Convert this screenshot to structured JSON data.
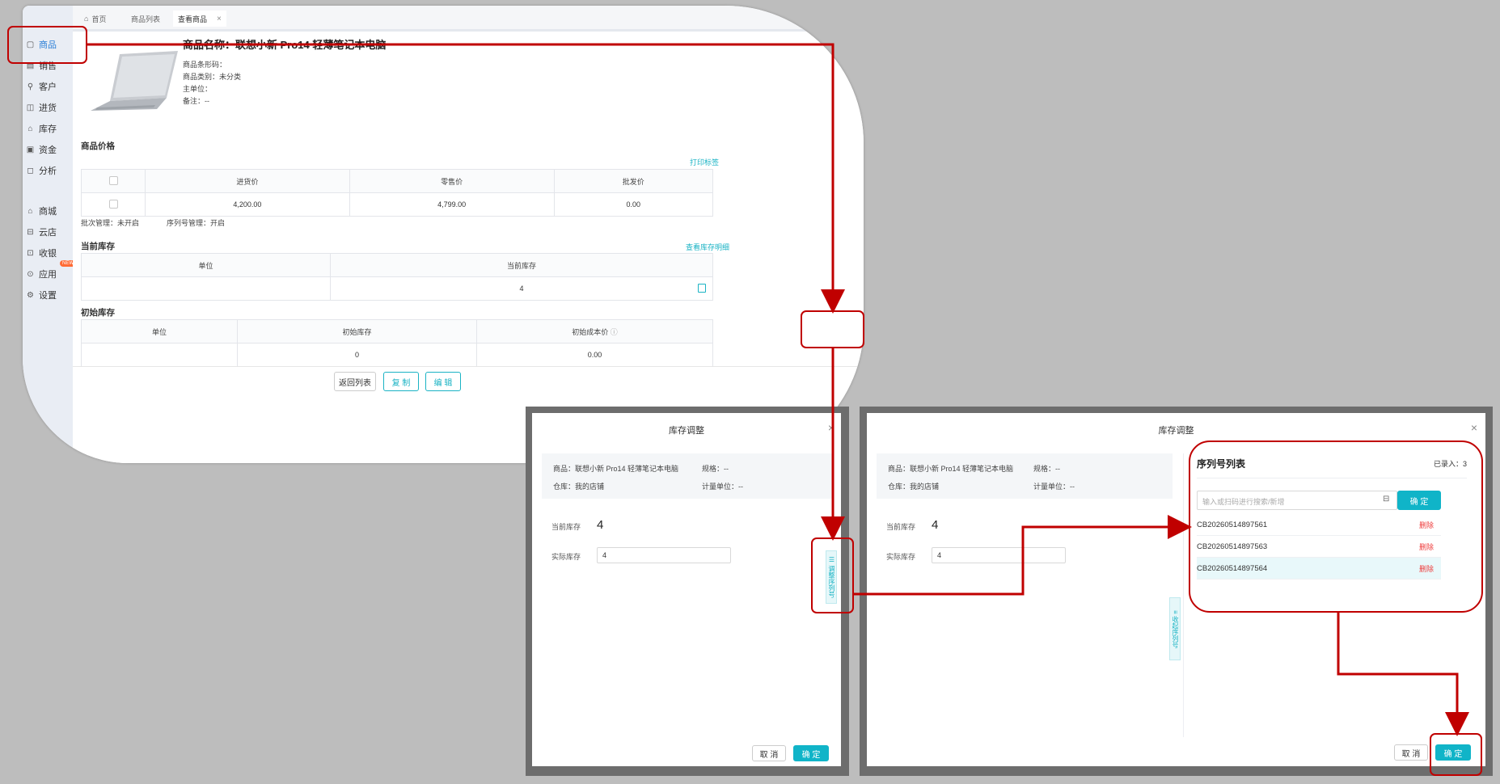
{
  "app": {
    "sidebar": [
      {
        "label": "商品",
        "icon": "box-icon",
        "active": true
      },
      {
        "label": "销售",
        "icon": "clipboard-icon"
      },
      {
        "label": "客户",
        "icon": "user-icon"
      },
      {
        "label": "进货",
        "icon": "truck-icon"
      },
      {
        "label": "库存",
        "icon": "warehouse-icon"
      },
      {
        "label": "资金",
        "icon": "wallet-icon"
      },
      {
        "label": "分析",
        "icon": "chart-icon"
      },
      {
        "label": "商城",
        "icon": "shop-icon"
      },
      {
        "label": "云店",
        "icon": "store-icon"
      },
      {
        "label": "收银",
        "icon": "monitor-icon"
      },
      {
        "label": "应用",
        "icon": "app-icon",
        "badge": "NEW"
      },
      {
        "label": "设置",
        "icon": "gear-icon"
      }
    ],
    "tabs": [
      "首页",
      "商品列表",
      "查看商品"
    ],
    "product": {
      "title": "商品名称：联想小新 Pro14 轻薄笔记本电脑",
      "barcode": "商品条形码：",
      "category": "商品类别：未分类",
      "unit": "主单位：",
      "remark": "备注：--"
    },
    "price_section": "商品价格",
    "print_tag": "打印标签",
    "price_headers": [
      "进货价",
      "零售价",
      "批发价"
    ],
    "price_values": [
      "4,200.00",
      "4,799.00",
      "0.00"
    ],
    "batch_mgmt": "批次管理：未开启",
    "serial_mgmt": "序列号管理：开启",
    "current_stock_section": "当前库存",
    "view_stock_link": "查看库存明细",
    "current_headers": [
      "单位",
      "当前库存"
    ],
    "current_values": [
      "",
      "4"
    ],
    "initial_stock_section": "初始库存",
    "initial_headers": [
      "单位",
      "初始库存",
      "初始成本价"
    ],
    "initial_values": [
      "",
      "0",
      "0.00"
    ],
    "buttons": {
      "back": "返回列表",
      "copy": "复 制",
      "edit": "编 辑"
    }
  },
  "dialog1": {
    "title": "库存调整",
    "product": "商品：联想小新 Pro14 轻薄笔记本电脑",
    "spec": "规格：--",
    "warehouse": "仓库：我的店铺",
    "measure_unit": "计量单位：--",
    "current_label": "当前库存",
    "current_value": "4",
    "actual_label": "实际库存",
    "actual_value": "4",
    "serial_btn": "☰ 调整序列号",
    "cancel": "取 消",
    "ok": "确 定"
  },
  "dialog2": {
    "title": "库存调整",
    "product": "商品：联想小新 Pro14 轻薄笔记本电脑",
    "spec": "规格：--",
    "warehouse": "仓库：我的店铺",
    "measure_unit": "计量单位：--",
    "current_label": "当前库存",
    "current_value": "4",
    "actual_label": "实际库存",
    "actual_value": "4",
    "collapse_btn": "≡ 收起序列号",
    "serial_panel": {
      "title": "序列号列表",
      "count": "已录入：3",
      "placeholder": "输入或扫码进行搜索/新增",
      "confirm": "确 定",
      "items": [
        "CB20260514897561",
        "CB20260514897563",
        "CB20260514897564"
      ],
      "delete": "删除"
    },
    "cancel": "取 消",
    "ok": "确 定"
  },
  "colors": {
    "accent": "#10b4c8",
    "highlight": "#c00000",
    "delete": "#ee3b3b",
    "sidebar_bg": "#e9edf4"
  }
}
